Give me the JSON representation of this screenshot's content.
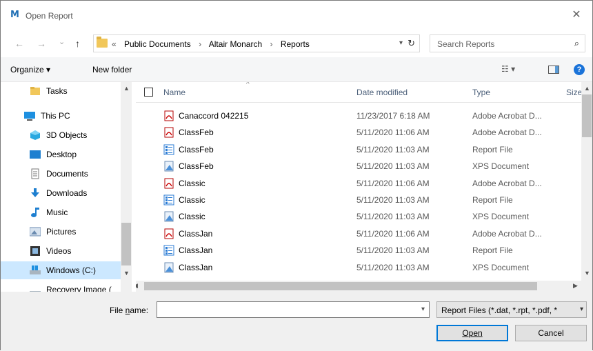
{
  "window": {
    "title": "Open Report",
    "close_glyph": "✕",
    "logo_letter": "M"
  },
  "nav": {
    "back": "←",
    "forward": "→",
    "recent": "⌄",
    "up": "↑",
    "breadcrumb": {
      "overflow": "«",
      "items": [
        "Public Documents",
        "Altair Monarch",
        "Reports"
      ],
      "separator": "›"
    },
    "refresh": "↻",
    "search_placeholder": "Search Reports"
  },
  "toolbar": {
    "organize": "Organize ▾",
    "new_folder": "New folder",
    "view": "☷ ▾",
    "help": "?"
  },
  "sidebar": {
    "items": [
      {
        "label": "Tasks",
        "icon": "folder-icon"
      },
      {
        "label": "This PC",
        "icon": "computer-icon"
      },
      {
        "label": "3D Objects",
        "icon": "3d-objects-icon"
      },
      {
        "label": "Desktop",
        "icon": "desktop-icon"
      },
      {
        "label": "Documents",
        "icon": "documents-icon"
      },
      {
        "label": "Downloads",
        "icon": "downloads-icon"
      },
      {
        "label": "Music",
        "icon": "music-icon"
      },
      {
        "label": "Pictures",
        "icon": "pictures-icon"
      },
      {
        "label": "Videos",
        "icon": "videos-icon"
      },
      {
        "label": "Windows (C:)",
        "icon": "drive-icon",
        "selected": true
      },
      {
        "label": "Recovery Image (",
        "icon": "drive-icon"
      }
    ]
  },
  "columns": {
    "name": "Name",
    "date": "Date modified",
    "type": "Type",
    "size": "Size"
  },
  "files": [
    {
      "name": "Canaccord 042215",
      "date": "11/23/2017 6:18 AM",
      "type": "Adobe Acrobat D...",
      "icon": "pdf"
    },
    {
      "name": "ClassFeb",
      "date": "5/11/2020 11:06 AM",
      "type": "Adobe Acrobat D...",
      "icon": "pdf"
    },
    {
      "name": "ClassFeb",
      "date": "5/11/2020 11:03 AM",
      "type": "Report File",
      "icon": "report"
    },
    {
      "name": "ClassFeb",
      "date": "5/11/2020 11:03 AM",
      "type": "XPS Document",
      "icon": "xps"
    },
    {
      "name": "Classic",
      "date": "5/11/2020 11:06 AM",
      "type": "Adobe Acrobat D...",
      "icon": "pdf"
    },
    {
      "name": "Classic",
      "date": "5/11/2020 11:03 AM",
      "type": "Report File",
      "icon": "report"
    },
    {
      "name": "Classic",
      "date": "5/11/2020 11:03 AM",
      "type": "XPS Document",
      "icon": "xps"
    },
    {
      "name": "ClassJan",
      "date": "5/11/2020 11:06 AM",
      "type": "Adobe Acrobat D...",
      "icon": "pdf"
    },
    {
      "name": "ClassJan",
      "date": "5/11/2020 11:03 AM",
      "type": "Report File",
      "icon": "report"
    },
    {
      "name": "ClassJan",
      "date": "5/11/2020 11:03 AM",
      "type": "XPS Document",
      "icon": "xps"
    }
  ],
  "footer": {
    "file_name_label": "File name:",
    "file_name_value": "",
    "file_type": "Report Files (*.dat, *.rpt, *.pdf, *",
    "open": "Open",
    "cancel": "Cancel"
  }
}
